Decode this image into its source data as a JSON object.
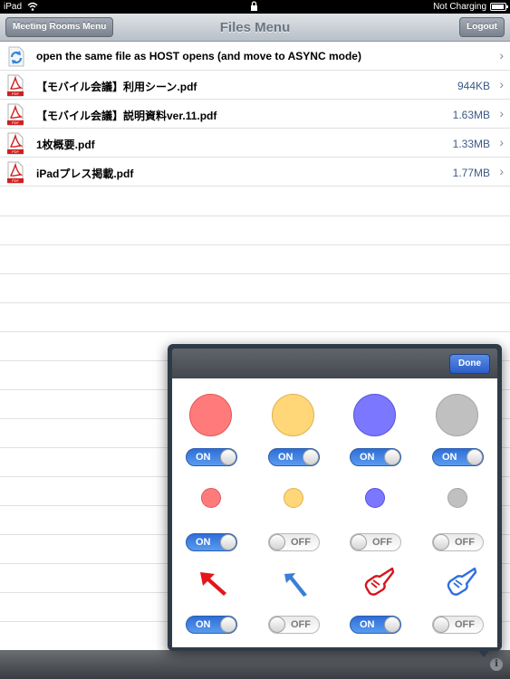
{
  "status_bar": {
    "carrier": "iPad",
    "charging": "Not Charging"
  },
  "nav": {
    "title": "Files Menu",
    "left_button": "Meeting Rooms Menu",
    "right_button": "Logout"
  },
  "files": [
    {
      "label": "open the same file as HOST opens (and move to ASYNC mode)",
      "size": "",
      "icon": "sync-icon"
    },
    {
      "label": "【モバイル会議】利用シーン.pdf",
      "size": "944KB",
      "icon": "pdf-icon"
    },
    {
      "label": "【モバイル会議】説明資料ver.11.pdf",
      "size": "1.63MB",
      "icon": "pdf-icon"
    },
    {
      "label": "1枚概要.pdf",
      "size": "1.33MB",
      "icon": "pdf-icon"
    },
    {
      "label": "iPadプレス掲載.pdf",
      "size": "1.77MB",
      "icon": "pdf-icon"
    }
  ],
  "popover": {
    "done_label": "Done",
    "colors": [
      "#ff7b7b",
      "#ffd678",
      "#7b78ff",
      "#c0c0c0"
    ],
    "large_toggles": [
      "ON",
      "ON",
      "ON",
      "ON"
    ],
    "small_toggles": [
      "ON",
      "OFF",
      "OFF",
      "OFF"
    ],
    "pointer_toggles": [
      "ON",
      "OFF",
      "ON",
      "OFF"
    ],
    "pointer_icons": [
      "red-arrow-icon",
      "blue-arrow-icon",
      "red-hand-icon",
      "blue-hand-icon"
    ]
  },
  "toolbar": {
    "info_label": "i"
  }
}
